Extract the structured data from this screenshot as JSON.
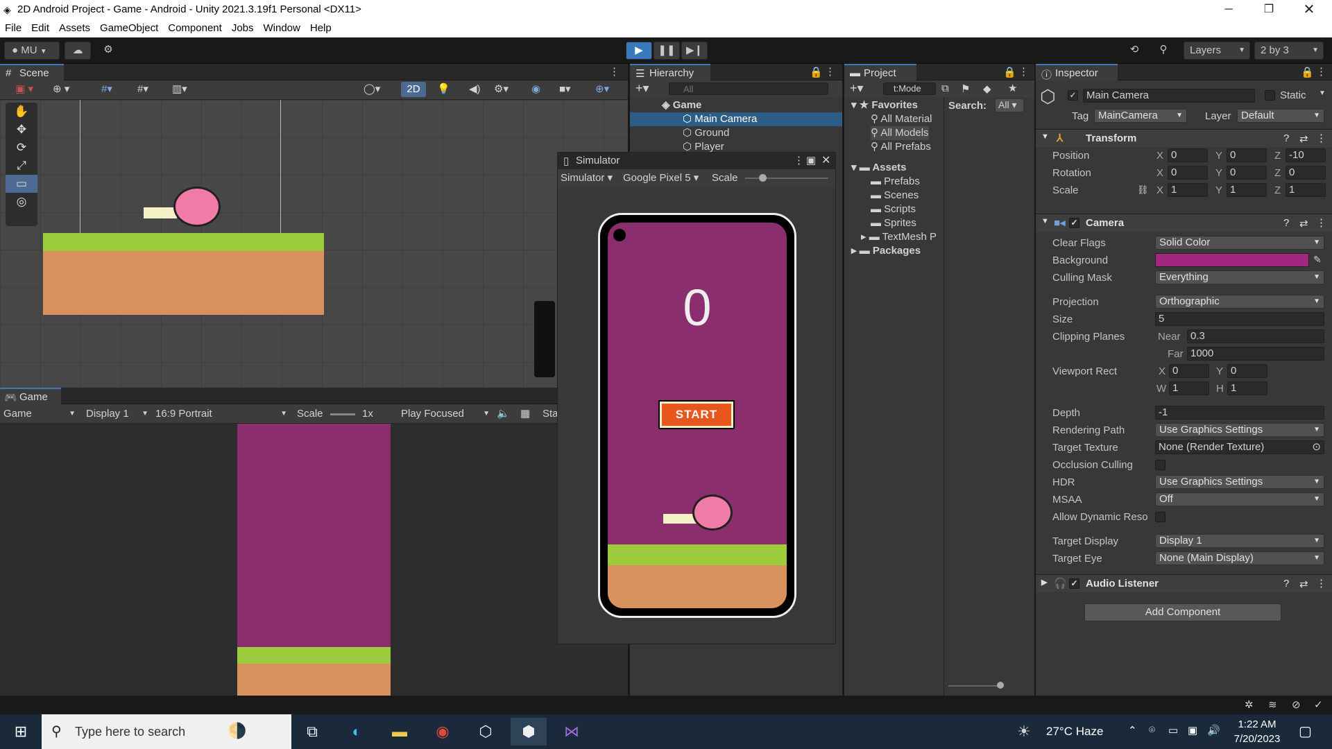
{
  "window": {
    "title": "2D Android Project - Game - Android - Unity 2021.3.19f1 Personal <DX11>"
  },
  "menu": [
    "File",
    "Edit",
    "Assets",
    "GameObject",
    "Component",
    "Jobs",
    "Window",
    "Help"
  ],
  "toolbar": {
    "account": "MU",
    "layers": "Layers",
    "layout": "2 by 3"
  },
  "scene": {
    "tab": "Scene",
    "btn_2d": "2D"
  },
  "game": {
    "tab": "Game",
    "mode": "Game",
    "display": "Display 1",
    "aspect": "16:9 Portrait",
    "scale_label": "Scale",
    "scale_value": "1x",
    "play_focused": "Play Focused",
    "stats": "Sta"
  },
  "hierarchy": {
    "tab": "Hierarchy",
    "search_placeholder": "All",
    "scene_name": "Game",
    "items": [
      "Main Camera",
      "Ground",
      "Player"
    ]
  },
  "simulator": {
    "tab": "Simulator",
    "mode": "Simulator",
    "device": "Google Pixel 5",
    "scale_label": "Scale",
    "score": "0",
    "start_label": "START"
  },
  "project": {
    "tab": "Project",
    "search_text": "t:Mode",
    "search_label": "Search:",
    "search_scope": "All",
    "favorites": "Favorites",
    "fav_items": [
      "All Material",
      "All Models",
      "All Prefabs"
    ],
    "assets": "Assets",
    "asset_items": [
      "Prefabs",
      "Scenes",
      "Scripts",
      "Sprites",
      "TextMesh P"
    ],
    "packages": "Packages"
  },
  "inspector": {
    "tab": "Inspector",
    "object_name": "Main Camera",
    "static_label": "Static",
    "tag_label": "Tag",
    "tag": "MainCamera",
    "layer_label": "Layer",
    "layer": "Default",
    "transform": {
      "title": "Transform",
      "rows": [
        {
          "label": "Position",
          "x": "0",
          "y": "0",
          "z": "-10"
        },
        {
          "label": "Rotation",
          "x": "0",
          "y": "0",
          "z": "0"
        },
        {
          "label": "Scale",
          "x": "1",
          "y": "1",
          "z": "1"
        }
      ]
    },
    "camera": {
      "title": "Camera",
      "clear_flags_label": "Clear Flags",
      "clear_flags": "Solid Color",
      "background_label": "Background",
      "background_color": "#a0267f",
      "culling_mask_label": "Culling Mask",
      "culling_mask": "Everything",
      "projection_label": "Projection",
      "projection": "Orthographic",
      "size_label": "Size",
      "size": "5",
      "clipping_label": "Clipping Planes",
      "near_label": "Near",
      "near": "0.3",
      "far_label": "Far",
      "far": "1000",
      "viewport_label": "Viewport Rect",
      "vx": "0",
      "vy": "0",
      "vw": "1",
      "vh": "1",
      "depth_label": "Depth",
      "depth": "-1",
      "rendering_path_label": "Rendering Path",
      "rendering_path": "Use Graphics Settings",
      "target_texture_label": "Target Texture",
      "target_texture": "None (Render Texture)",
      "occlusion_label": "Occlusion Culling",
      "hdr_label": "HDR",
      "hdr": "Use Graphics Settings",
      "msaa_label": "MSAA",
      "msaa": "Off",
      "dynamic_label": "Allow Dynamic Reso",
      "target_display_label": "Target Display",
      "target_display": "Display 1",
      "target_eye_label": "Target Eye",
      "target_eye": "None (Main Display)"
    },
    "audio_listener": "Audio Listener",
    "add_component": "Add Component"
  },
  "taskbar": {
    "search_placeholder": "Type here to search",
    "weather": "27°C  Haze",
    "time": "1:22 AM",
    "date": "7/20/2023"
  },
  "colors": {
    "game_bg": "#8b2e6e",
    "grass": "#9ccb3b",
    "dirt": "#d9915e",
    "start_btn": "#e8561e",
    "accent_blue": "#3a79bb"
  }
}
